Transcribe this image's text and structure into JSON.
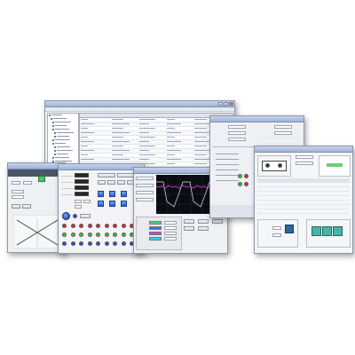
{
  "colors": {
    "title_bar": "#9fb3d6",
    "window_bg": "#f2f2f2",
    "led_green": "#2bd12b",
    "led_red": "#e02a2a",
    "led_blue": "#2a4fd8",
    "scope_bg": "#0b0b12",
    "scope_trace_white": "#e8e8e8",
    "scope_trace_magenta": "#e030e0",
    "gauge_dark": "#1e2b1e"
  },
  "icons": [
    "minimize-icon",
    "maximize-icon",
    "close-icon",
    "tree-node-icon",
    "knob-icon"
  ],
  "windows": {
    "back_table": {
      "title": "",
      "rows": 18
    },
    "controls": {
      "title": ""
    },
    "scope": {
      "title": ""
    },
    "right_top": {
      "title": ""
    },
    "right_main": {
      "title": ""
    }
  }
}
